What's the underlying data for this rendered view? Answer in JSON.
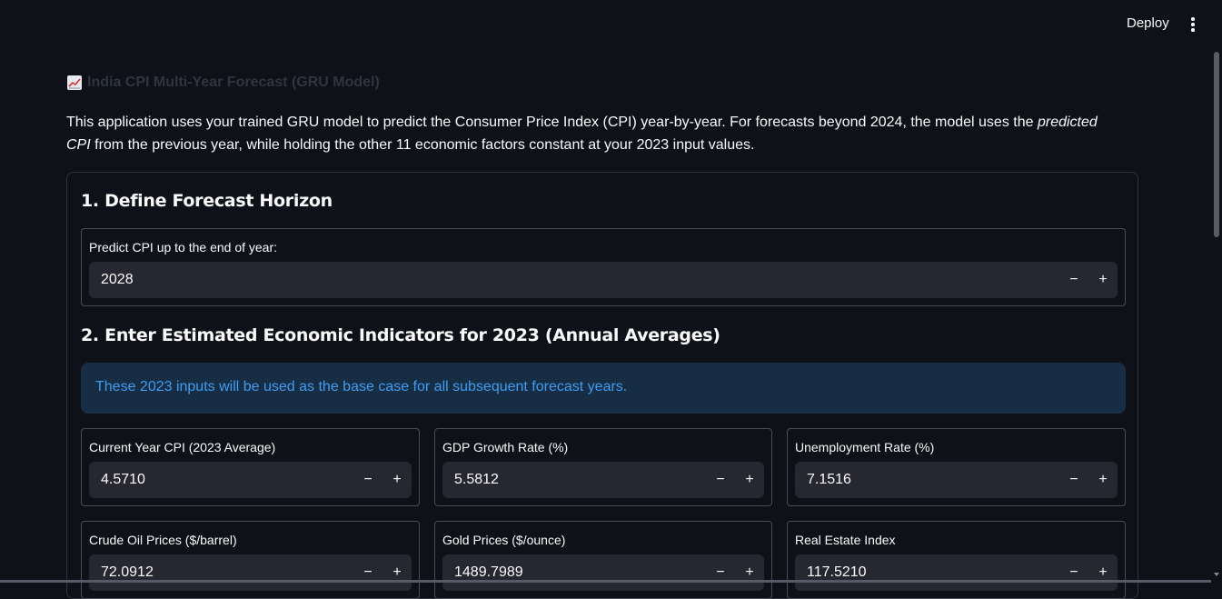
{
  "topbar": {
    "deploy_label": "Deploy",
    "menu_icon": "kebab-menu-icon"
  },
  "header": {
    "title": "India CPI Multi-Year Forecast (GRU Model)",
    "title_icon": "chart-increasing-icon"
  },
  "intro": {
    "part1": "This application uses your trained GRU model to predict the Consumer Price Index (CPI) year-by-year. For forecasts beyond 2024, the model uses the",
    "emphasis": "predicted CPI",
    "part2": "from the previous year, while holding the other 11 economic factors constant at your 2023 input values."
  },
  "section1": {
    "heading": "1. Define Forecast Horizon",
    "field": {
      "label": "Predict CPI up to the end of year:",
      "value": "2028",
      "minus": "−",
      "plus": "+"
    }
  },
  "section2": {
    "heading": "2. Enter Estimated Economic Indicators for 2023 (Annual Averages)",
    "info": "These 2023 inputs will be used as the base case for all subsequent forecast years.",
    "fields": [
      {
        "label": "Current Year CPI (2023 Average)",
        "value": "4.5710"
      },
      {
        "label": "GDP Growth Rate (%)",
        "value": "5.5812"
      },
      {
        "label": "Unemployment Rate (%)",
        "value": "7.1516"
      },
      {
        "label": "Crude Oil Prices ($/barrel)",
        "value": "72.0912"
      },
      {
        "label": "Gold Prices ($/ounce)",
        "value": "1489.7989"
      },
      {
        "label": "Real Estate Index",
        "value": "117.5210"
      }
    ],
    "minus": "−",
    "plus": "+"
  },
  "colors": {
    "background": "#0e1117",
    "input_bg": "#262730",
    "info_bg": "#172d43",
    "info_text": "#3d9df3"
  }
}
